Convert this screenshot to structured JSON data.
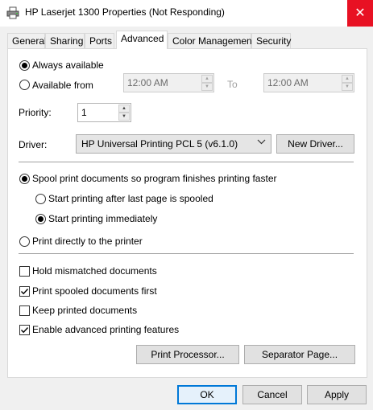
{
  "window": {
    "title": "HP Laserjet 1300 Properties (Not Responding)",
    "close_glyph": "✕"
  },
  "tabs": [
    {
      "label": "General",
      "active": false
    },
    {
      "label": "Sharing",
      "active": false
    },
    {
      "label": "Ports",
      "active": false
    },
    {
      "label": "Advanced",
      "active": true
    },
    {
      "label": "Color Management",
      "active": false
    },
    {
      "label": "Security",
      "active": false
    }
  ],
  "availability": {
    "always_label": "Always available",
    "from_label": "Available from",
    "selected": "always",
    "from_time": "12:00 AM",
    "to_label": "To",
    "to_time": "12:00 AM"
  },
  "priority": {
    "label": "Priority:",
    "value": "1"
  },
  "driver": {
    "label": "Driver:",
    "selected": "HP Universal Printing PCL 5 (v6.1.0)",
    "new_driver_label": "New Driver..."
  },
  "spooling": {
    "spool_label": "Spool print documents so program finishes printing faster",
    "after_last_page_label": "Start printing after last page is spooled",
    "immediately_label": "Start printing immediately",
    "direct_label": "Print directly to the printer",
    "selected_mode": "spool",
    "selected_start": "immediately"
  },
  "options": [
    {
      "label": "Hold mismatched documents",
      "checked": false
    },
    {
      "label": "Print spooled documents first",
      "checked": true
    },
    {
      "label": "Keep printed documents",
      "checked": false
    },
    {
      "label": "Enable advanced printing features",
      "checked": true
    }
  ],
  "panel_buttons": {
    "print_processor": "Print Processor...",
    "separator_page": "Separator Page..."
  },
  "dialog_buttons": {
    "ok": "OK",
    "cancel": "Cancel",
    "apply": "Apply"
  },
  "colors": {
    "close_red": "#e81123",
    "default_button_border": "#0078d7"
  }
}
